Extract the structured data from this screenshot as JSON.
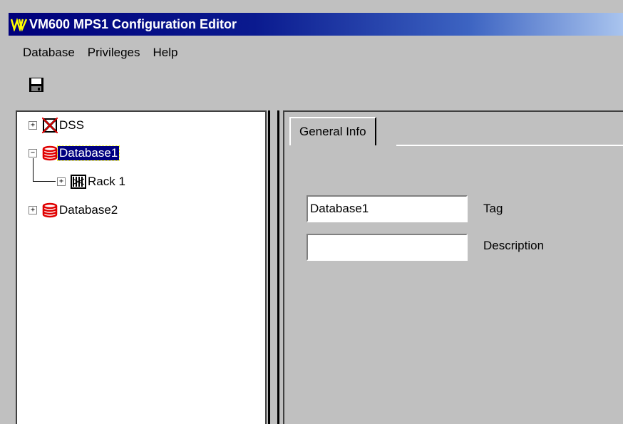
{
  "window": {
    "title": "VM600 MPS1 Configuration Editor"
  },
  "menu": {
    "items": [
      "Database",
      "Privileges",
      "Help"
    ]
  },
  "toolbar": {
    "save_icon": "floppy-disk-icon"
  },
  "tree": {
    "nodes": [
      {
        "label": "DSS",
        "icon": "dss-disabled-icon",
        "expander": "+"
      },
      {
        "label": "Database1",
        "icon": "database-icon",
        "expander": "−",
        "selected": true
      },
      {
        "label": "Rack 1",
        "icon": "rack-icon",
        "expander": "+"
      },
      {
        "label": "Database2",
        "icon": "database-icon",
        "expander": "+"
      }
    ]
  },
  "tabs": [
    {
      "label": "General Info",
      "active": true
    }
  ],
  "form": {
    "tag": {
      "value": "Database1",
      "label": "Tag"
    },
    "description": {
      "value": "",
      "label": "Description"
    }
  },
  "colors": {
    "title_bar": "#00007b",
    "selection": "#000080",
    "database_red": "#e00000",
    "face": "#c0c0c0"
  }
}
